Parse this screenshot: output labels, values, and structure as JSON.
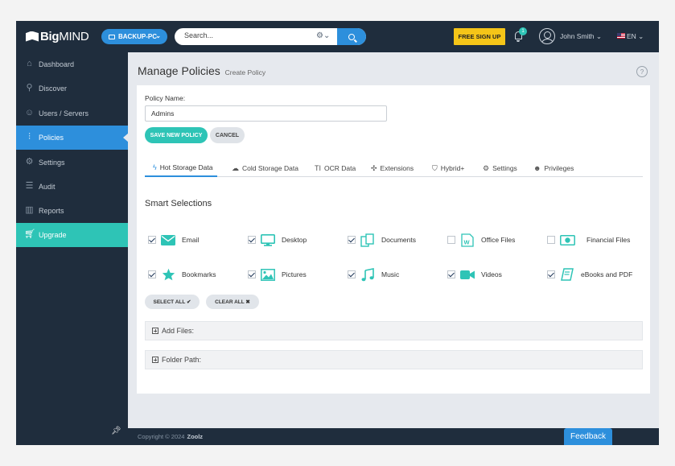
{
  "app": {
    "logo_bold": "Big",
    "logo_thin": "MIND"
  },
  "topbar": {
    "device": "BACKUP-PC",
    "search_placeholder": "Search...",
    "signup": "FREE SIGN UP",
    "notifications": "1",
    "user": "John Smith",
    "lang": "EN"
  },
  "sidebar": {
    "items": [
      {
        "label": "Dashboard",
        "icon": "home-icon"
      },
      {
        "label": "Discover",
        "icon": "search-icon"
      },
      {
        "label": "Users / Servers",
        "icon": "users-icon"
      },
      {
        "label": "Policies",
        "icon": "sliders-icon"
      },
      {
        "label": "Settings",
        "icon": "gear-icon"
      },
      {
        "label": "Audit",
        "icon": "list-icon"
      },
      {
        "label": "Reports",
        "icon": "bar-chart-icon"
      },
      {
        "label": "Upgrade",
        "icon": "cart-icon"
      }
    ],
    "active": "Policies"
  },
  "header": {
    "title": "Manage Policies",
    "subtitle": "Create Policy",
    "help": "?"
  },
  "form": {
    "name_label": "Policy Name:",
    "name_value": "Admins",
    "save": "SAVE NEW POLICY",
    "cancel": "CANCEL"
  },
  "tabs": [
    {
      "label": "Hot Storage Data",
      "icon": "bolt-icon"
    },
    {
      "label": "Cold Storage Data",
      "icon": "cloud-icon"
    },
    {
      "label": "OCR Data",
      "icon": "text-icon"
    },
    {
      "label": "Extensions",
      "icon": "puzzle-icon"
    },
    {
      "label": "Hybrid+",
      "icon": "shield-icon"
    },
    {
      "label": "Settings",
      "icon": "cogs-icon"
    },
    {
      "label": "Privileges",
      "icon": "users-icon"
    }
  ],
  "smart": {
    "title": "Smart Selections",
    "items": [
      {
        "label": "Email",
        "checked": true,
        "icon": "email-icon"
      },
      {
        "label": "Desktop",
        "checked": true,
        "icon": "desktop-icon"
      },
      {
        "label": "Documents",
        "checked": true,
        "icon": "documents-icon"
      },
      {
        "label": "Office Files",
        "checked": false,
        "icon": "word-file-icon"
      },
      {
        "label": "Financial Files",
        "checked": false,
        "icon": "money-icon"
      },
      {
        "label": "Bookmarks",
        "checked": true,
        "icon": "star-icon"
      },
      {
        "label": "Pictures",
        "checked": true,
        "icon": "picture-icon"
      },
      {
        "label": "Music",
        "checked": true,
        "icon": "music-icon"
      },
      {
        "label": "Videos",
        "checked": true,
        "icon": "video-camera-icon"
      },
      {
        "label": "eBooks and PDF",
        "checked": true,
        "icon": "book-icon"
      }
    ],
    "select_all": "SELECT ALL ✔",
    "clear_all": "CLEAR ALL ✖"
  },
  "accordions": {
    "add_files": "Add Files:",
    "folder_path": "Folder Path:"
  },
  "footer": {
    "copyright": "Copyright © 2024",
    "brand": "Zoolz",
    "feedback": "Feedback"
  },
  "colors": {
    "navy": "#1f2d3d",
    "blue": "#2d8fdc",
    "teal": "#2ec4b6",
    "yellow": "#f5c518"
  }
}
